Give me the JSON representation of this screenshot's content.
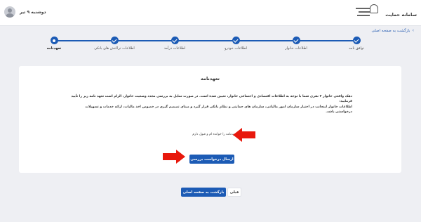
{
  "header": {
    "brand_title": "سامانه حمایت",
    "date": "دوشنبه ۹ تیر"
  },
  "nav": {
    "back_label": "بازگشت به صفحه اصلی"
  },
  "steps": [
    {
      "label": "توافق نامه",
      "state": "done"
    },
    {
      "label": "اطلاعات خانوار",
      "state": "done"
    },
    {
      "label": "اطلاعات خودرو",
      "state": "done"
    },
    {
      "label": "اطلاعات درآمد",
      "state": "done"
    },
    {
      "label": "اطلاعات تراکنش های بانکی",
      "state": "done"
    },
    {
      "label": "تعهدنامه",
      "state": "current"
    }
  ],
  "commitment": {
    "title": "تعهدنامه",
    "paragraph_line1": "دهک واقعی خانوار ۳ نفری شما با توجه به اطلاعات اقتصادی و اجتماعی خانوار، تعیین شده است. در صورت تمایل به بررسی مجدد وضعیت خانوار، الزام است تعهد نامه زیر را تأیید فرمایید:",
    "paragraph_line2": "اطلاعات خانوار اینجانب در اختیار سازمان امور مالیاتی، سازمان های حمایتی و نظام بانکی قرار گیرد و مبنای تصمیم گیری در خصوص اخذ مالیات، ارائه خدمات و تسهیلات درخواستی باشد.",
    "agree_label": "متن تعهدنامه را خوانده ام و قبول دارم",
    "agree_checked": true,
    "submit_label": "ارسال درخواست بررسی"
  },
  "footer": {
    "home_label": "بازگشت به صفحه اصلی",
    "prev_label": "قبلی"
  },
  "colors": {
    "primary": "#1c5bb5",
    "arrow": "#e8180c",
    "background": "#eeeff3"
  }
}
